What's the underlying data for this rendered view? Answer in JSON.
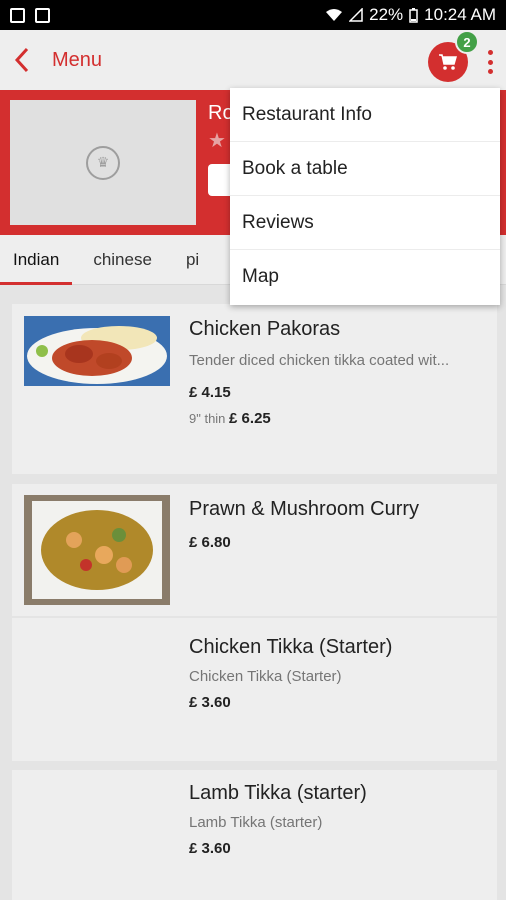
{
  "status": {
    "battery": "22%",
    "time": "10:24 AM"
  },
  "appbar": {
    "title": "Menu",
    "cart_count": "2"
  },
  "restaurant": {
    "name_partial": "Ro"
  },
  "tabs": [
    {
      "label": "Indian"
    },
    {
      "label": "chinese"
    },
    {
      "label": "pi"
    }
  ],
  "items": [
    {
      "title": "Chicken Pakoras",
      "desc": "Tender diced chicken tikka coated wit...",
      "price": "£ 4.15",
      "variant_label": "9\" thin",
      "variant_price": "£ 6.25"
    },
    {
      "title": "Prawn & Mushroom Curry",
      "desc": "",
      "price": "£ 6.80"
    },
    {
      "title": "Chicken Tikka (Starter)",
      "desc": "Chicken Tikka (Starter)",
      "price": "£ 3.60"
    },
    {
      "title": "Lamb Tikka (starter)",
      "desc": "Lamb Tikka (starter)",
      "price": "£ 3.60"
    }
  ],
  "menu": [
    {
      "label": "Restaurant Info"
    },
    {
      "label": "Book a table"
    },
    {
      "label": "Reviews"
    },
    {
      "label": "Map"
    }
  ],
  "colors": {
    "accent": "#d32f2f",
    "badge": "#43a047"
  }
}
